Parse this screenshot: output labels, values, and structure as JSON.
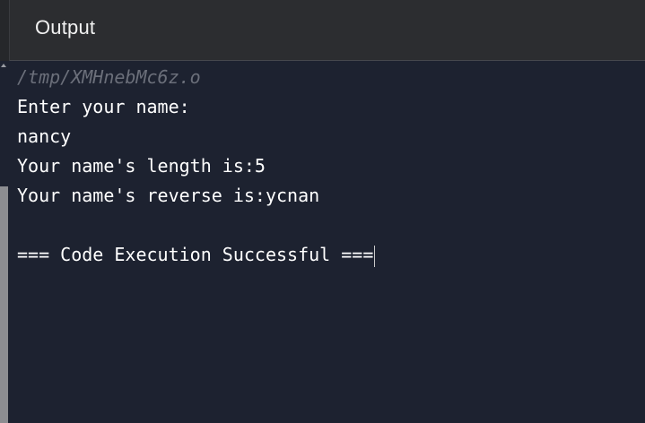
{
  "header": {
    "title": "Output"
  },
  "console": {
    "path": "/tmp/XMHnebMc6z.o",
    "lines": [
      "Enter your name:",
      "nancy",
      "Your name's length is:5",
      "Your name's reverse is:ycnan",
      "",
      "=== Code Execution Successful ==="
    ]
  },
  "colors": {
    "background": "#1d2230",
    "header_background": "#2c2d30",
    "text": "#ffffff",
    "path_text": "#6b6f7a"
  },
  "icons": {
    "scroll_up": "scroll-up-icon"
  }
}
